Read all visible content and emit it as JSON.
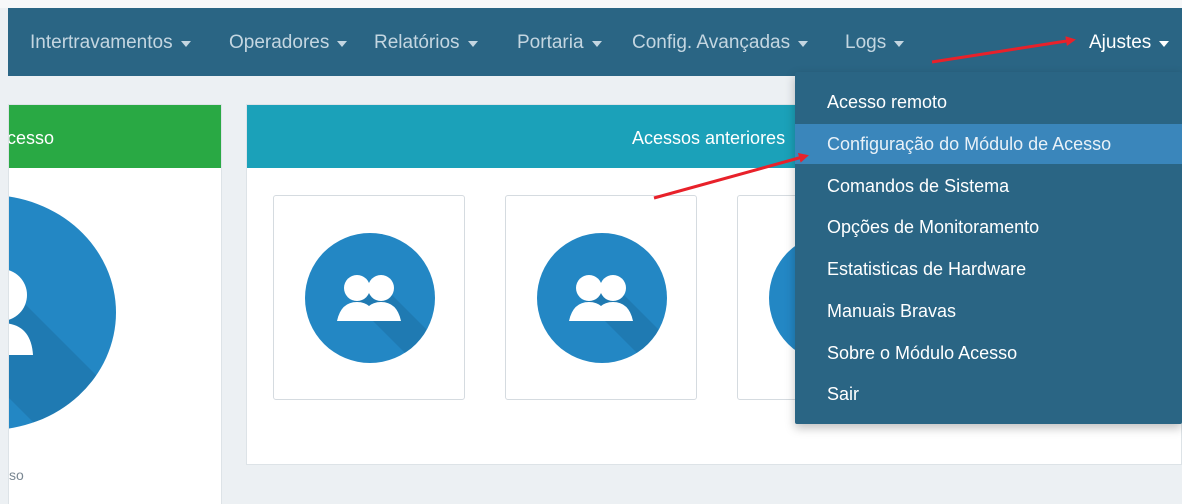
{
  "navbar": {
    "items": [
      {
        "label": "Intertravamentos"
      },
      {
        "label": "Operadores"
      },
      {
        "label": "Relatórios"
      },
      {
        "label": "Portaria"
      },
      {
        "label": "Config. Avançadas"
      },
      {
        "label": "Logs"
      }
    ],
    "settings_label": "Ajustes"
  },
  "left_panel": {
    "header": "cesso",
    "footer": "so",
    "header_color": "#29a944"
  },
  "right_panel": {
    "header": "Acessos anteriores",
    "header_color": "#1ba1b9",
    "cards": [
      {
        "icon": "user-group-icon"
      },
      {
        "icon": "user-group-icon"
      },
      {
        "icon": "user-group-icon"
      }
    ]
  },
  "dropdown": {
    "items": [
      {
        "label": "Acesso remoto"
      },
      {
        "label": "Configuração do Módulo de Acesso"
      },
      {
        "label": "Comandos de Sistema"
      },
      {
        "label": "Opções de Monitoramento"
      },
      {
        "label": "Estatisticas de Hardware"
      },
      {
        "label": "Manuais Bravas"
      },
      {
        "label": "Sobre o Módulo Acesso"
      },
      {
        "label": "Sair"
      }
    ],
    "highlighted": "Configuração do Módulo de Acesso"
  },
  "colors": {
    "navbar": "#2a6584",
    "accent_blue": "#2387c4",
    "annotation_arrow": "#e8212a"
  }
}
